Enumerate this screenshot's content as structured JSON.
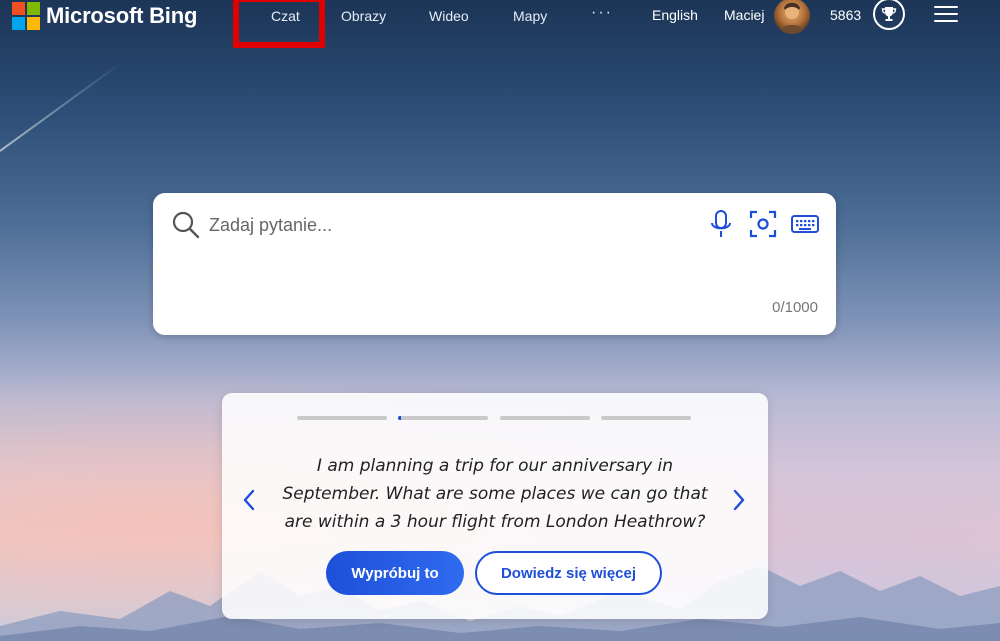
{
  "logo": {
    "text": "Microsoft Bing",
    "colors": [
      "#f25022",
      "#7fba00",
      "#00a4ef",
      "#ffb900"
    ]
  },
  "nav": {
    "items": [
      "Czat",
      "Obrazy",
      "Wideo",
      "Mapy"
    ],
    "more": "···",
    "highlighted_item": "Czat"
  },
  "header": {
    "language": "English",
    "user_name": "Maciej",
    "points": "5863"
  },
  "search": {
    "placeholder": "Zadaj pytanie...",
    "value": "",
    "char_count": "0/1000",
    "tools": [
      "microphone-icon",
      "visual-search-icon",
      "keyboard-icon"
    ]
  },
  "suggestion_card": {
    "progress": [
      0,
      0.03,
      0,
      0
    ],
    "prompt": "I am planning a trip for our anniversary in September. What are some places we can go that are within a 3 hour flight from London Heathrow?",
    "try_button": "Wypróbuj to",
    "learn_more_button": "Dowiedz się więcej"
  },
  "colors": {
    "accent": "#1e4fd8",
    "highlight_box": "#e00000"
  }
}
